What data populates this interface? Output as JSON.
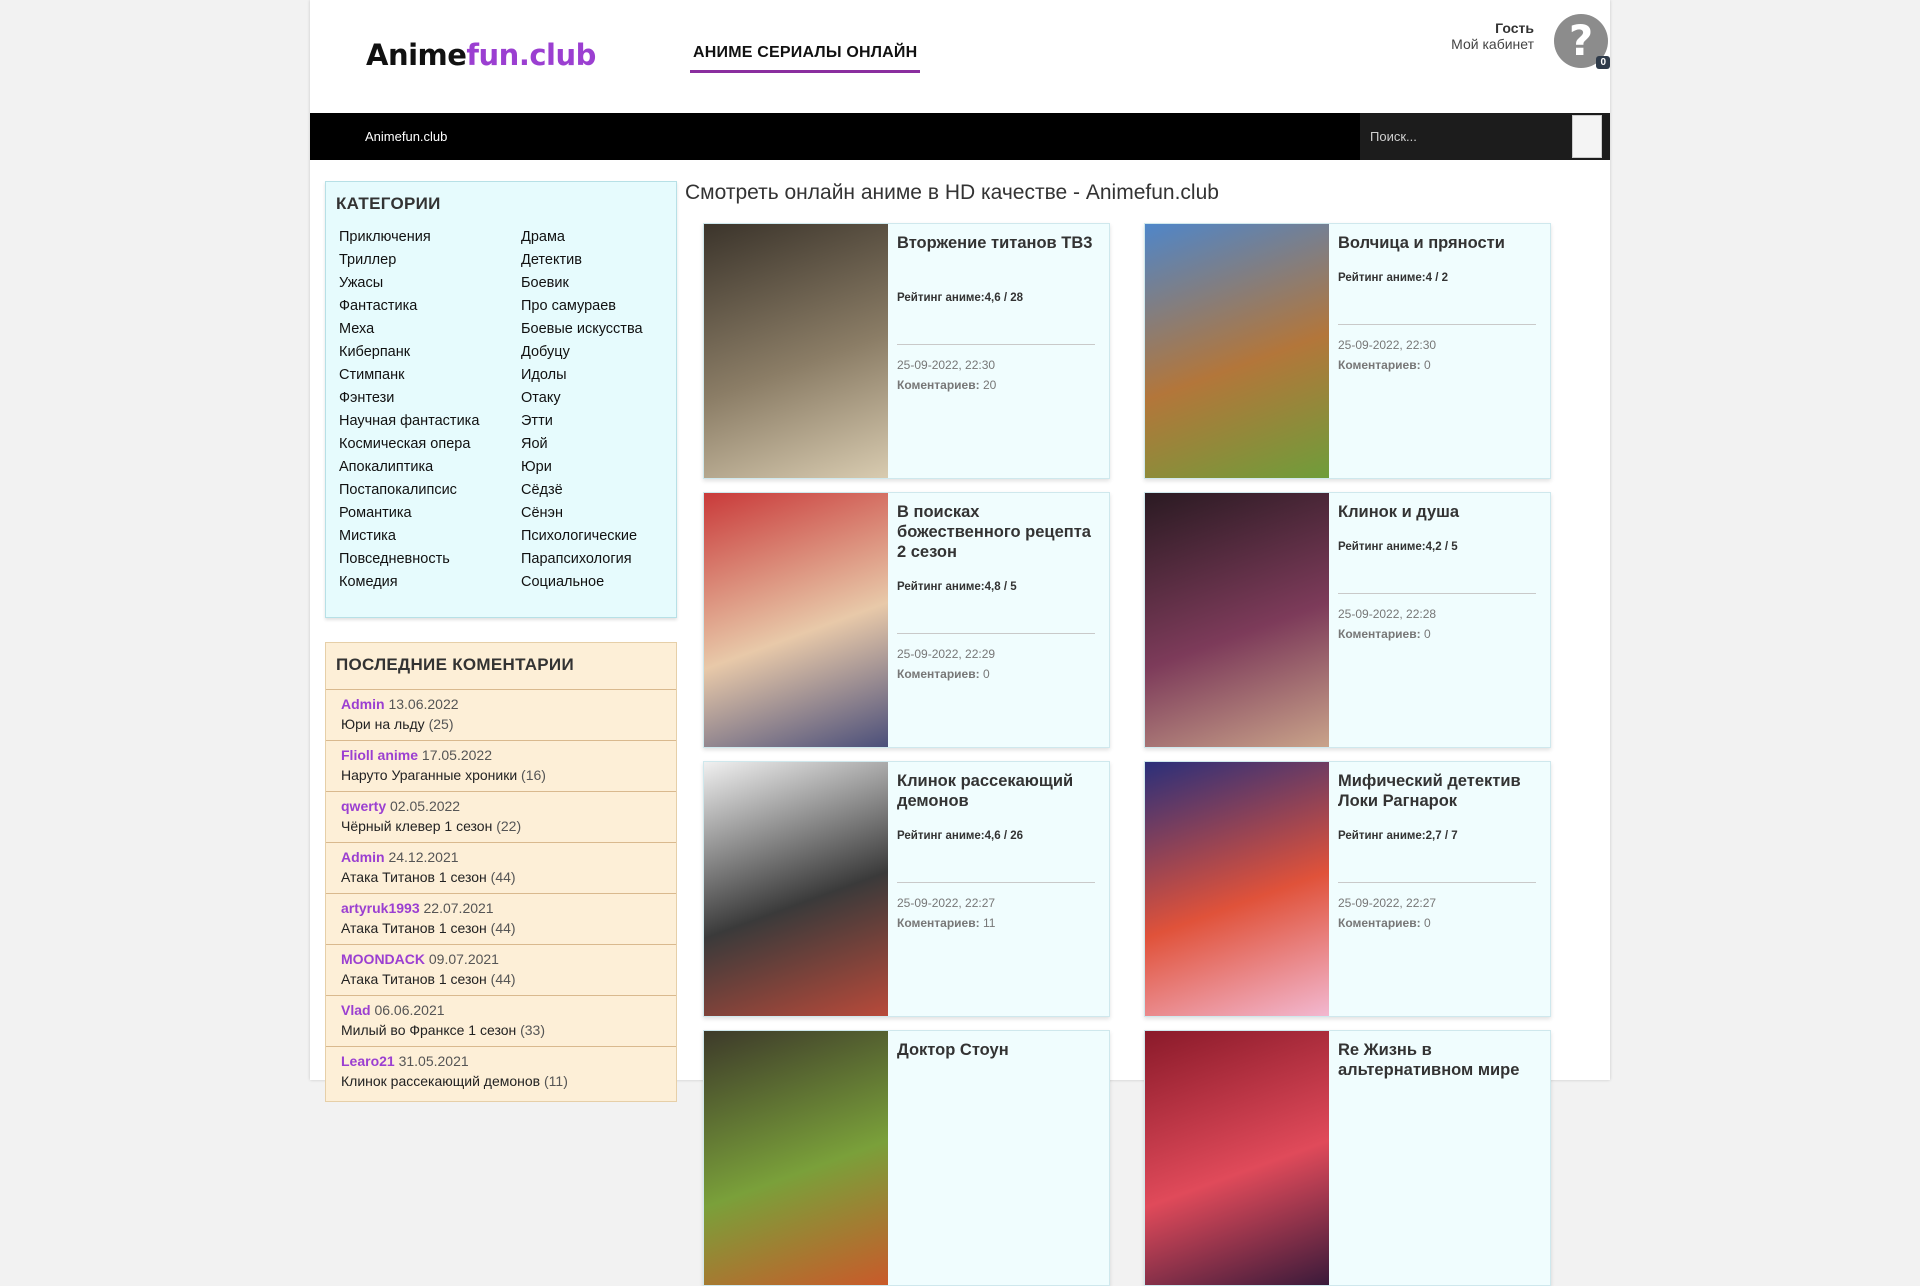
{
  "logo": {
    "part1": "Anime",
    "part2": "fun.club"
  },
  "header": {
    "nav_label": "АНИМЕ СЕРИАЛЫ ОНЛАЙН"
  },
  "user": {
    "name": "Гость",
    "cabinet": "Мой кабинет",
    "avatar_glyph": "?",
    "badge": "0"
  },
  "menubar": {
    "home": "Animefun.club",
    "search_placeholder": "Поиск..."
  },
  "categories": {
    "title": "КАТЕГОРИИ",
    "col1": [
      "Приключения",
      "Триллер",
      "Ужасы",
      "Фантастика",
      "Меха",
      "Киберпанк",
      "Стимпанк",
      "Фэнтези",
      "Научная фантастика",
      "Космическая опера",
      "Апокалиптика",
      "Постапокалипсис",
      "Романтика",
      "Мистика",
      "Повседневность",
      "Комедия"
    ],
    "col2": [
      "Драма",
      "Детектив",
      "Боевик",
      "Про самураев",
      "Боевые искусства",
      "Добуцу",
      "Идолы",
      "Отаку",
      "Этти",
      "Яой",
      "Юри",
      "Сёдзё",
      "Сёнэн",
      "Психологические",
      "Парапсихология",
      "Социальное"
    ]
  },
  "comments": {
    "title": "ПОСЛЕДНИЕ КОМЕНТАРИИ",
    "items": [
      {
        "author": "Admin",
        "date": "13.06.2022",
        "title": "Юри на льду",
        "count": "(25)"
      },
      {
        "author": "Flioll anime",
        "date": "17.05.2022",
        "title": "Наруто Ураганные хроники",
        "count": "(16)"
      },
      {
        "author": "qwerty",
        "date": "02.05.2022",
        "title": "Чёрный клевер 1 сезон",
        "count": "(22)"
      },
      {
        "author": "Admin",
        "date": "24.12.2021",
        "title": "Атака Титанов 1 сезон",
        "count": "(44)"
      },
      {
        "author": "artyruk1993",
        "date": "22.07.2021",
        "title": "Атака Титанов 1 сезон",
        "count": "(44)"
      },
      {
        "author": "MOONDACK",
        "date": "09.07.2021",
        "title": "Атака Титанов 1 сезон",
        "count": "(44)"
      },
      {
        "author": "Vlad",
        "date": "06.06.2021",
        "title": "Милый во Франксе 1 сезон",
        "count": "(33)"
      },
      {
        "author": "Learo21",
        "date": "31.05.2021",
        "title": "Клинок рассекающий демонов",
        "count": "(11)"
      }
    ]
  },
  "main": {
    "title": "Смотреть онлайн аниме в HD качестве - Animefun.club",
    "rating_label": "Рейтинг аниме:",
    "comments_label": "Коментариев:",
    "cards": [
      {
        "title": "Вторжение титанов ТВ3",
        "rating": "4,6 / 28",
        "date": "25-09-2022, 22:30",
        "comments": "20",
        "colors": [
          "#3b342b",
          "#8b7d66",
          "#d8cbb0"
        ]
      },
      {
        "title": "Волчица и пряности",
        "rating": "4 / 2",
        "date": "25-09-2022, 22:30",
        "comments": "0",
        "colors": [
          "#4f86c9",
          "#b3763a",
          "#6f9d3a"
        ]
      },
      {
        "title": "В поисках божественного рецепта 2 сезон",
        "rating": "4,8 / 5",
        "date": "25-09-2022, 22:29",
        "comments": "0",
        "colors": [
          "#c93a3a",
          "#e8c9a9",
          "#4b4f7a"
        ]
      },
      {
        "title": "Клинок и душа",
        "rating": "4,2 / 5",
        "date": "25-09-2022, 22:28",
        "comments": "0",
        "colors": [
          "#2a1a22",
          "#7d3b5a",
          "#c9a38a"
        ]
      },
      {
        "title": "Клинок рассекающий демонов",
        "rating": "4,6 / 26",
        "date": "25-09-2022, 22:27",
        "comments": "11",
        "colors": [
          "#f0f0f0",
          "#3a3a3a",
          "#b84a3a"
        ]
      },
      {
        "title": "Мифический детектив Локи Рагнарок",
        "rating": "2,7 / 7",
        "date": "25-09-2022, 22:27",
        "comments": "0",
        "colors": [
          "#2a2f7a",
          "#e0523a",
          "#f2b8d0"
        ]
      },
      {
        "title": "Доктор Стоун",
        "rating": "",
        "date": "",
        "comments": "",
        "colors": [
          "#3d3a2a",
          "#7aa03a",
          "#c95a2a"
        ]
      },
      {
        "title": "Re Жизнь в альтернативном мире",
        "rating": "",
        "date": "",
        "comments": "",
        "colors": [
          "#8a1a2a",
          "#e04a5a",
          "#3a1a3a"
        ]
      }
    ]
  }
}
